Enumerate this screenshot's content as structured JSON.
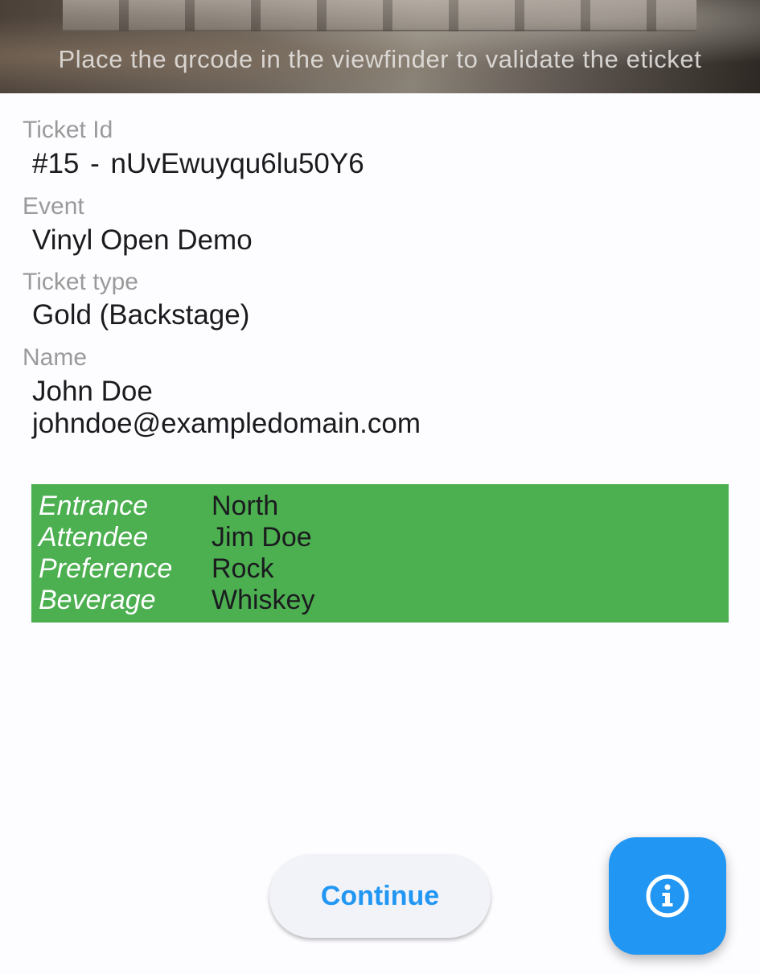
{
  "scanner": {
    "hint": "Place the qrcode in the viewfinder to validate the eticket"
  },
  "ticket": {
    "id_label": "Ticket Id",
    "id_value": "#15  -  nUvEwuyqu6lu50Y6",
    "event_label": "Event",
    "event_value": "Vinyl Open Demo",
    "type_label": "Ticket type",
    "type_value": "Gold (Backstage)",
    "name_label": "Name",
    "name_value": "John Doe",
    "email_value": "johndoe@exampledomain.com"
  },
  "details": [
    {
      "key": "Entrance",
      "value": "North"
    },
    {
      "key": "Attendee",
      "value": "Jim Doe"
    },
    {
      "key": "Preference",
      "value": "Rock"
    },
    {
      "key": "Beverage",
      "value": "Whiskey"
    }
  ],
  "actions": {
    "continue_label": "Continue",
    "info_icon": "info-icon"
  },
  "colors": {
    "accent": "#2196f3",
    "details_background": "#4caf50",
    "label_gray": "#9a9a9a"
  }
}
